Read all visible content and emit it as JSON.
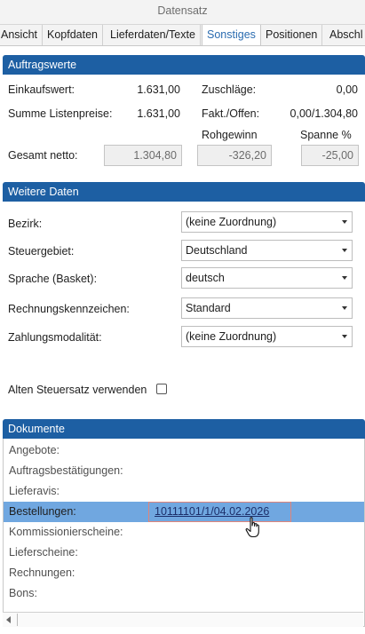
{
  "window": {
    "title": "Datensatz"
  },
  "tabs": [
    {
      "label": "Ansicht"
    },
    {
      "label": "Kopfdaten"
    },
    {
      "label": "Lieferdaten/Texte"
    },
    {
      "label": "Sonstiges"
    },
    {
      "label": "Positionen"
    },
    {
      "label": "Abschl"
    }
  ],
  "active_tab": "Sonstiges",
  "auftragswerte": {
    "header": "Auftragswerte",
    "einkaufswert_label": "Einkaufswert:",
    "einkaufswert_value": "1.631,00",
    "zuschlaege_label": "Zuschläge:",
    "zuschlaege_value": "0,00",
    "summe_listenpreise_label": "Summe Listenpreise:",
    "summe_listenpreise_value": "1.631,00",
    "fakt_offen_label": "Fakt./Offen:",
    "fakt_offen_value": "0,00/1.304,80",
    "rohgewinn_label": "Rohgewinn",
    "spanne_label": "Spanne %",
    "gesamt_netto_label": "Gesamt netto:",
    "gesamt_netto_value": "1.304,80",
    "rohgewinn_value": "-326,20",
    "spanne_value": "-25,00"
  },
  "weitere_daten": {
    "header": "Weitere Daten",
    "bezirk_label": "Bezirk:",
    "bezirk_value": "(keine Zuordnung)",
    "steuergebiet_label": "Steuergebiet:",
    "steuergebiet_value": "Deutschland",
    "sprache_label": "Sprache (Basket):",
    "sprache_value": "deutsch",
    "rechnungskennzeichen_label": "Rechnungskennzeichen:",
    "rechnungskennzeichen_value": "Standard",
    "zahlungsmodalitaet_label": "Zahlungsmodalität:",
    "zahlungsmodalitaet_value": "(keine Zuordnung)",
    "alten_steuersatz_label": "Alten Steuersatz verwenden",
    "alten_steuersatz_checked": false
  },
  "dokumente": {
    "header": "Dokumente",
    "rows": [
      {
        "label": "Angebote:",
        "link": ""
      },
      {
        "label": "Auftragsbestätigungen:",
        "link": ""
      },
      {
        "label": "Lieferavis:",
        "link": ""
      },
      {
        "label": "Bestellungen:",
        "link": "10111101/1/04.02.2026"
      },
      {
        "label": "Kommissionierscheine:",
        "link": ""
      },
      {
        "label": "Lieferscheine:",
        "link": ""
      },
      {
        "label": "Rechnungen:",
        "link": ""
      },
      {
        "label": "Bons:",
        "link": ""
      }
    ],
    "selected_row": "Bestellungen:"
  },
  "colors": {
    "panel_header": "#1d5fa3",
    "selected_row": "#70a7e0",
    "active_tab_text": "#2b6cb0"
  }
}
